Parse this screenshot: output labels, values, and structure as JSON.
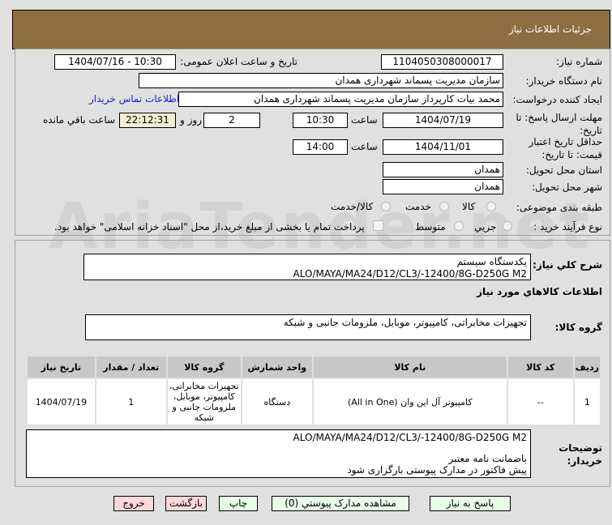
{
  "header": {
    "title": "جزئیات اطلاعات نیاز"
  },
  "watermark": "AriaTender.net",
  "form": {
    "need_number_label": "شماره نیاز:",
    "need_number": "1104050308000017",
    "announce_label": "تاریخ و ساعت اعلان عمومی:",
    "announce_value": "1404/07/16 - 10:30",
    "buyer_label": "نام دستگاه خریدار:",
    "buyer_value": "سازمان مدیریت پسماند شهرداری همدان",
    "creator_label": "ایجاد کننده درخواست:",
    "creator_value": "محمد بیات کارپرداز سازمان مدیریت پسماند شهرداری همدان",
    "contact_link": "اطلاعات تماس خریدار",
    "deadline_label": "مهلت ارسال پاسخ: تا تاریخ:",
    "deadline_date": "1404/07/19",
    "time_label": "ساعت",
    "deadline_time": "10:30",
    "days": "2",
    "days_label": "روز و",
    "remaining": "22:12:31",
    "remaining_label": "ساعت باقي مانده",
    "validity_label": "حداقل تاریخ اعتبار قیمت: تا تاریخ:",
    "validity_date": "1404/11/01",
    "validity_time": "14:00",
    "province_label": "استان محل تحویل:",
    "province": "همدان",
    "city_label": "شهر محل تحویل:",
    "city": "همدان",
    "category_label": "طبقه بندی موضوعی:",
    "category_options": [
      "کالا",
      "خدمت",
      "کالا/خدمت"
    ],
    "process_label": "نوع فرآیند خرید :",
    "process_options": [
      "جزیي",
      "متوسط"
    ],
    "payment_note": "پرداخت تمام یا بخشی از مبلغ خرید،از محل \"اسناد خزانه اسلامی\" خواهد بود."
  },
  "details": {
    "desc_label": "شرح کلي نیاز:",
    "desc_line1": "یکدستگاه سیستم",
    "desc_line2": "ALO/MAYA/MA24/D12/CL3/-12400/8G-D250G  M2",
    "goods_heading": "اطلاعات کالاهاي مورد نیاز",
    "group_label": "گروه کالا:",
    "group_value": "تجهیزات مخابراتی، کامپیوتر، موبایل، ملزومات جانبی و شبکه",
    "table": {
      "headers": [
        "ردیف",
        "کد کالا",
        "نام کالا",
        "واحد شمارش",
        "گروه کالا",
        "تعداد / مقدار",
        "تاریخ نیاز"
      ],
      "rows": [
        [
          "1",
          "--",
          "کامپیوتر آل این وان (All in One)",
          "دستگاه",
          "تجهیزات مخابراتی، کامپیوتر، موبایل، ملزومات جانبی و شبکه",
          "1",
          "1404/07/19"
        ]
      ]
    },
    "notes_label": "توضیحات خریدار:",
    "notes_line1": "ALO/MAYA/MA24/D12/CL3/-12400/8G-D250G  M2",
    "notes_line2": "باضمانت نامه معتبر",
    "notes_line3": "پیش فاکتور در مدارک پیوستی بارگزاری شود"
  },
  "buttons": {
    "reply": "پاسخ به نیاز",
    "attachments": "مشاهده مدارک پیوستي (0)",
    "print": "چاپ",
    "back": "بازگشت",
    "exit": "خروج"
  }
}
